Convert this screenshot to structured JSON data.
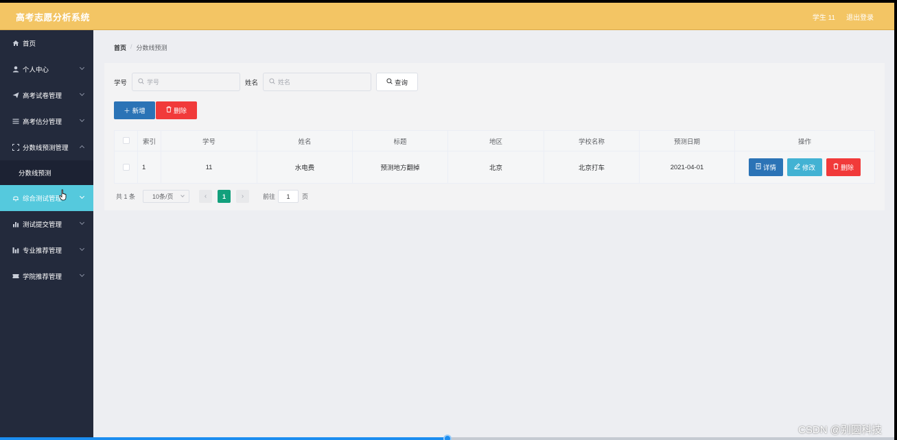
{
  "header": {
    "app_title": "高考志愿分析系统",
    "user": "学生 11",
    "logout": "退出登录",
    "bg_color": "#f3c564"
  },
  "sidebar": {
    "items": [
      {
        "label": "首页",
        "icon": "home-icon"
      },
      {
        "label": "个人中心",
        "icon": "user-icon"
      },
      {
        "label": "高考试卷管理",
        "icon": "send-icon"
      },
      {
        "label": "高考估分管理",
        "icon": "list-icon"
      },
      {
        "label": "分数线预测管理",
        "icon": "fullscreen-icon"
      },
      {
        "label": "分数线预测",
        "icon": ""
      },
      {
        "label": "综合测试管理",
        "icon": "bell-icon"
      },
      {
        "label": "测试提交管理",
        "icon": "bar-chart-icon"
      },
      {
        "label": "专业推荐管理",
        "icon": "bar-chart-icon"
      },
      {
        "label": "学院推荐管理",
        "icon": "ticket-icon"
      }
    ],
    "active_color": "#55c9dd"
  },
  "breadcrumb": {
    "home": "首页",
    "separator": "/",
    "current": "分数线预测"
  },
  "search": {
    "field1_label": "学号",
    "field1_placeholder": "学号",
    "field2_label": "姓名",
    "field2_placeholder": "姓名",
    "query_button": "查询"
  },
  "actions": {
    "add": "新增",
    "delete": "删除"
  },
  "table": {
    "columns": [
      "索引",
      "学号",
      "姓名",
      "标题",
      "地区",
      "学校名称",
      "预测日期",
      "操作"
    ],
    "rows": [
      {
        "index": "1",
        "student_id": "11",
        "name": "水电费",
        "title": "预测地方翻掉",
        "region": "北京",
        "school": "北京打车",
        "date": "2021-04-01"
      }
    ],
    "op_detail": "详情",
    "op_edit": "修改",
    "op_delete": "删除"
  },
  "pagination": {
    "total": "共 1 条",
    "page_size": "10条/页",
    "current_page": "1",
    "goto_label": "前往",
    "goto_value": "1",
    "page_suffix": "页"
  },
  "watermark": "CSDN @别圆科技",
  "video_progress": 0.5
}
